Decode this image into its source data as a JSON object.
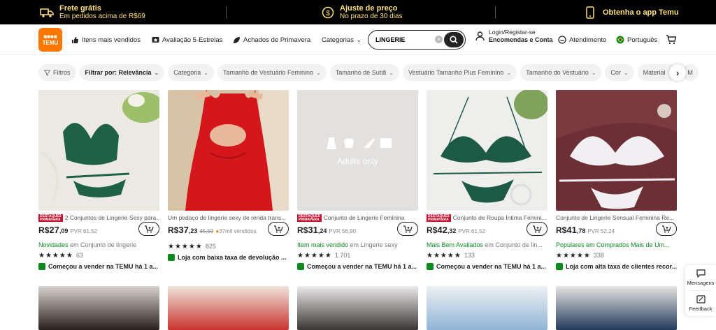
{
  "topbar": {
    "shipping_title": "Frete grátis",
    "shipping_sub": "Em pedidos acima de R$69",
    "price_title": "Ajuste de preço",
    "price_sub": "No prazo de 30 dias",
    "app_label": "Obtenha o app Temu"
  },
  "header": {
    "logo_text_top": "■■■■",
    "logo_text_bottom": "TEMU",
    "nav": {
      "best_sellers": "Itens mais vendidos",
      "five_star": "Avaliação 5-Estrelas",
      "spring": "Achados de Primavera",
      "categories": "Categorias"
    },
    "search": {
      "value": "LINGERIE"
    },
    "account": {
      "line1": "Login/Registar-se",
      "line2": "Encomendas e Conta"
    },
    "support": "Atendimento",
    "language": "Português"
  },
  "filters": [
    {
      "label": "Filtros",
      "icon": "filter-icon"
    },
    {
      "label": "Filtrar por: Relevância",
      "dark": true
    },
    {
      "label": "Categoria"
    },
    {
      "label": "Tamanho de Vestuário Feminino"
    },
    {
      "label": "Tamanho de Sutiã"
    },
    {
      "label": "Vestuário Tamanho Plus Feminino"
    },
    {
      "label": "Tamanho do Vestuário"
    },
    {
      "label": "Cor"
    },
    {
      "label": "Material"
    },
    {
      "label": "M"
    }
  ],
  "products": [
    {
      "badge": "DESTAQUES PRIMAVERA",
      "title": "2 Conjuntos de Lingerie Sexy para...",
      "currency": "R$",
      "price_int": "27",
      "price_cents": ",09",
      "pvr": "PVR 61,52",
      "strike": "",
      "sold": "",
      "tag_green": "Novidades",
      "tag_dim": " em Conjunto de lingerie",
      "stars": "★★★★★",
      "rating_count": "63",
      "trust": "Começou a vender na TEMU há 1 a..."
    },
    {
      "badge": "",
      "title": "Um pedaço de lingerie sexy de renda trans...",
      "currency": "R$",
      "price_int": "37",
      "price_cents": ",23",
      "pvr": "",
      "strike": "45,59",
      "sold": "37mil vendidos",
      "tag_green": "",
      "tag_dim": "",
      "stars": "★★★★★",
      "rating_count": "825",
      "trust": "Loja com baixa taxa de devolução ..."
    },
    {
      "badge": "DESTAQUES PRIMAVERA",
      "title": "Conjunto de Lingerie Feminina",
      "currency": "R$",
      "price_int": "31",
      "price_cents": ",24",
      "pvr": "PVR 56,90",
      "strike": "",
      "sold": "",
      "tag_green": "Item mais vendido",
      "tag_dim": " em Lingerie sexy",
      "stars": "★★★★★",
      "rating_count": "1.701",
      "trust": "Começou a vender na TEMU há 1 a...",
      "adults_only": "Adults only"
    },
    {
      "badge": "DESTAQUES PRIMAVERA",
      "title": "Conjunto de Roupa Íntima Femini...",
      "currency": "R$",
      "price_int": "42",
      "price_cents": ",32",
      "pvr": "PVR 61,52",
      "strike": "",
      "sold": "",
      "tag_green": "Mais Bem Avaliados",
      "tag_dim": " em Conjunto de lin...",
      "stars": "★★★★★",
      "rating_count": "133",
      "trust": "Começou a vender na TEMU há 1 a..."
    },
    {
      "badge": "",
      "title": "Conjunto de Lingerie Sensual Feminina Re...",
      "currency": "R$",
      "price_int": "41",
      "price_cents": ",78",
      "pvr": "PVR 52,24",
      "strike": "",
      "sold": "",
      "tag_green": "Populares em Comprados Mais de Um...",
      "tag_dim": "",
      "stars": "★★★★★",
      "rating_count": "338",
      "trust": "Loja com alta taxa de clientes recor..."
    }
  ],
  "side": {
    "messages": "Mensagens",
    "feedback": "Feedback"
  },
  "colors": {
    "brand": "#fb7701",
    "green": "#0a8a1f",
    "badge_red": "#c8102e",
    "topbar_text": "#ffe07a"
  }
}
